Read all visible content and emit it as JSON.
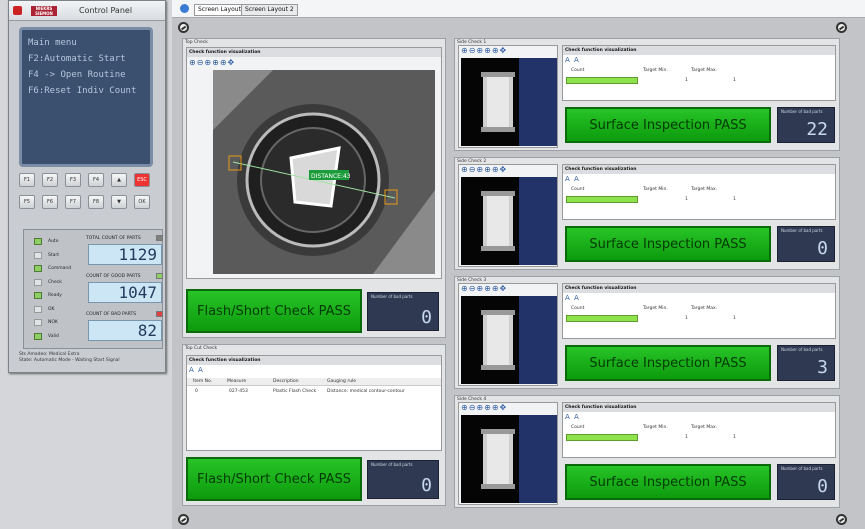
{
  "control_panel": {
    "title": "Control Panel",
    "logo": "NIEKRS SIEMON",
    "menu": [
      "Main menu",
      "F2:Automatic Start",
      "F4 -> Open Routine",
      "F6:Reset Indiv Count"
    ],
    "keys_row1": [
      "F1",
      "F2",
      "F3",
      "F4",
      "▲",
      "ESC"
    ],
    "keys_row2": [
      "F5",
      "F6",
      "F7",
      "F8",
      "▼",
      "OK"
    ],
    "status_leds": [
      {
        "label": "Auto",
        "on": true
      },
      {
        "label": "Start",
        "on": false
      },
      {
        "label": "Command",
        "on": true
      },
      {
        "label": "Check",
        "on": false
      },
      {
        "label": "Ready",
        "on": true
      },
      {
        "label": "OK",
        "on": false
      },
      {
        "label": "NOK",
        "on": false
      },
      {
        "label": "Valid",
        "on": true
      }
    ],
    "counters": [
      {
        "label": "TOTAL COUNT OF PARTS",
        "value": "1129",
        "color": "#808080"
      },
      {
        "label": "COUNT OF GOOD PARTS",
        "value": "1047",
        "color": "#8dcf62"
      },
      {
        "label": "COUNT OF BAD PARTS",
        "value": "82",
        "color": "#e04040"
      }
    ],
    "footer_line1": "Sts Amadeo: Medical Extra",
    "footer_line2": "State: Automatic Mode - Waiting Start Signal"
  },
  "tabs": [
    "Screen Layout 1",
    "Screen Layout 2"
  ],
  "top_check": {
    "title": "Top Check",
    "vis_title": "Check function visualization",
    "measure_tag": "DISTANCE:43",
    "result": "Flash/Short Check PASS",
    "bad_label": "Number of bad parts",
    "bad_value": "0"
  },
  "top_cut_check": {
    "title": "Top Cut Check",
    "vis_title": "Check function visualization",
    "columns": [
      "Item No.",
      "Measure",
      "Description",
      "Gauging rule"
    ],
    "row": [
      "0",
      "027-453",
      "Plastic Flash Check",
      "Distance: medical contour-contour"
    ],
    "result": "Flash/Short Check PASS",
    "bad_label": "Number of bad parts",
    "bad_value": "0"
  },
  "side_checks": [
    {
      "title": "Side Check 1",
      "vis_title": "Check function visualization",
      "cols": [
        "Count",
        "Target Min.",
        "Target Max."
      ],
      "min": "1",
      "max": "1",
      "result": "Surface Inspection PASS",
      "bad_label": "Number of bad parts",
      "bad_value": "22"
    },
    {
      "title": "Side Check 2",
      "vis_title": "Check function visualization",
      "cols": [
        "Count",
        "Target Min.",
        "Target Max."
      ],
      "min": "1",
      "max": "1",
      "result": "Surface Inspection PASS",
      "bad_label": "Number of bad parts",
      "bad_value": "0"
    },
    {
      "title": "Side Check 3",
      "vis_title": "Check function visualization",
      "cols": [
        "Count",
        "Target Min.",
        "Target Max."
      ],
      "min": "1",
      "max": "1",
      "result": "Surface Inspection PASS",
      "bad_label": "Number of bad parts",
      "bad_value": "3"
    },
    {
      "title": "Side Check 4",
      "vis_title": "Check function visualization",
      "cols": [
        "Count",
        "Target Min.",
        "Target Max."
      ],
      "min": "1",
      "max": "1",
      "result": "Surface Inspection PASS",
      "bad_label": "Number of bad parts",
      "bad_value": "0"
    }
  ],
  "zoom_icons": "⊕⊖⊕⊕⊕✥",
  "colors": {
    "pass_green": "#1db31d",
    "lcd_blue": "#3b4f6e",
    "count_bar": "#8ee34c"
  }
}
